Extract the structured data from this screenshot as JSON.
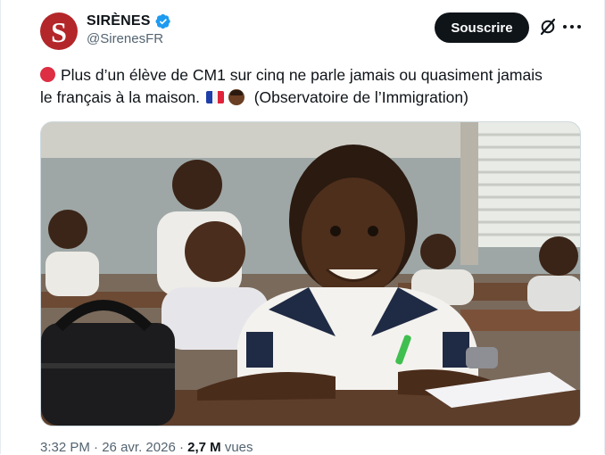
{
  "account": {
    "display_name": "SIRÈNES",
    "handle": "@SirenesFR",
    "avatar_letter": "S",
    "avatar_color": "#b3262a",
    "verified": true
  },
  "actions": {
    "subscribe_label": "Souscrire",
    "grok_icon": "grok-icon",
    "more_icon": "more-icon"
  },
  "tweet": {
    "text_line1": "Plus d’un élève de CM1 sur cinq ne parle jamais ou quasiment jamais",
    "text_line2_start": "le français à la maison.",
    "text_line2_end": "(Observatoire de l’Immigration)",
    "emojis": [
      "red-circle",
      "flag-france",
      "person-dark-skin"
    ]
  },
  "media": {
    "description_icon": "classroom-photo"
  },
  "meta": {
    "time": "3:32 PM",
    "separator": "·",
    "date": "26 avr. 2026",
    "views_count": "2,7 M",
    "views_label": "vues"
  },
  "colors": {
    "accent_dark": "#0f1419",
    "secondary_text": "#536471",
    "verified_blue": "#1d9bf0",
    "red_emoji": "#dd2e44"
  }
}
